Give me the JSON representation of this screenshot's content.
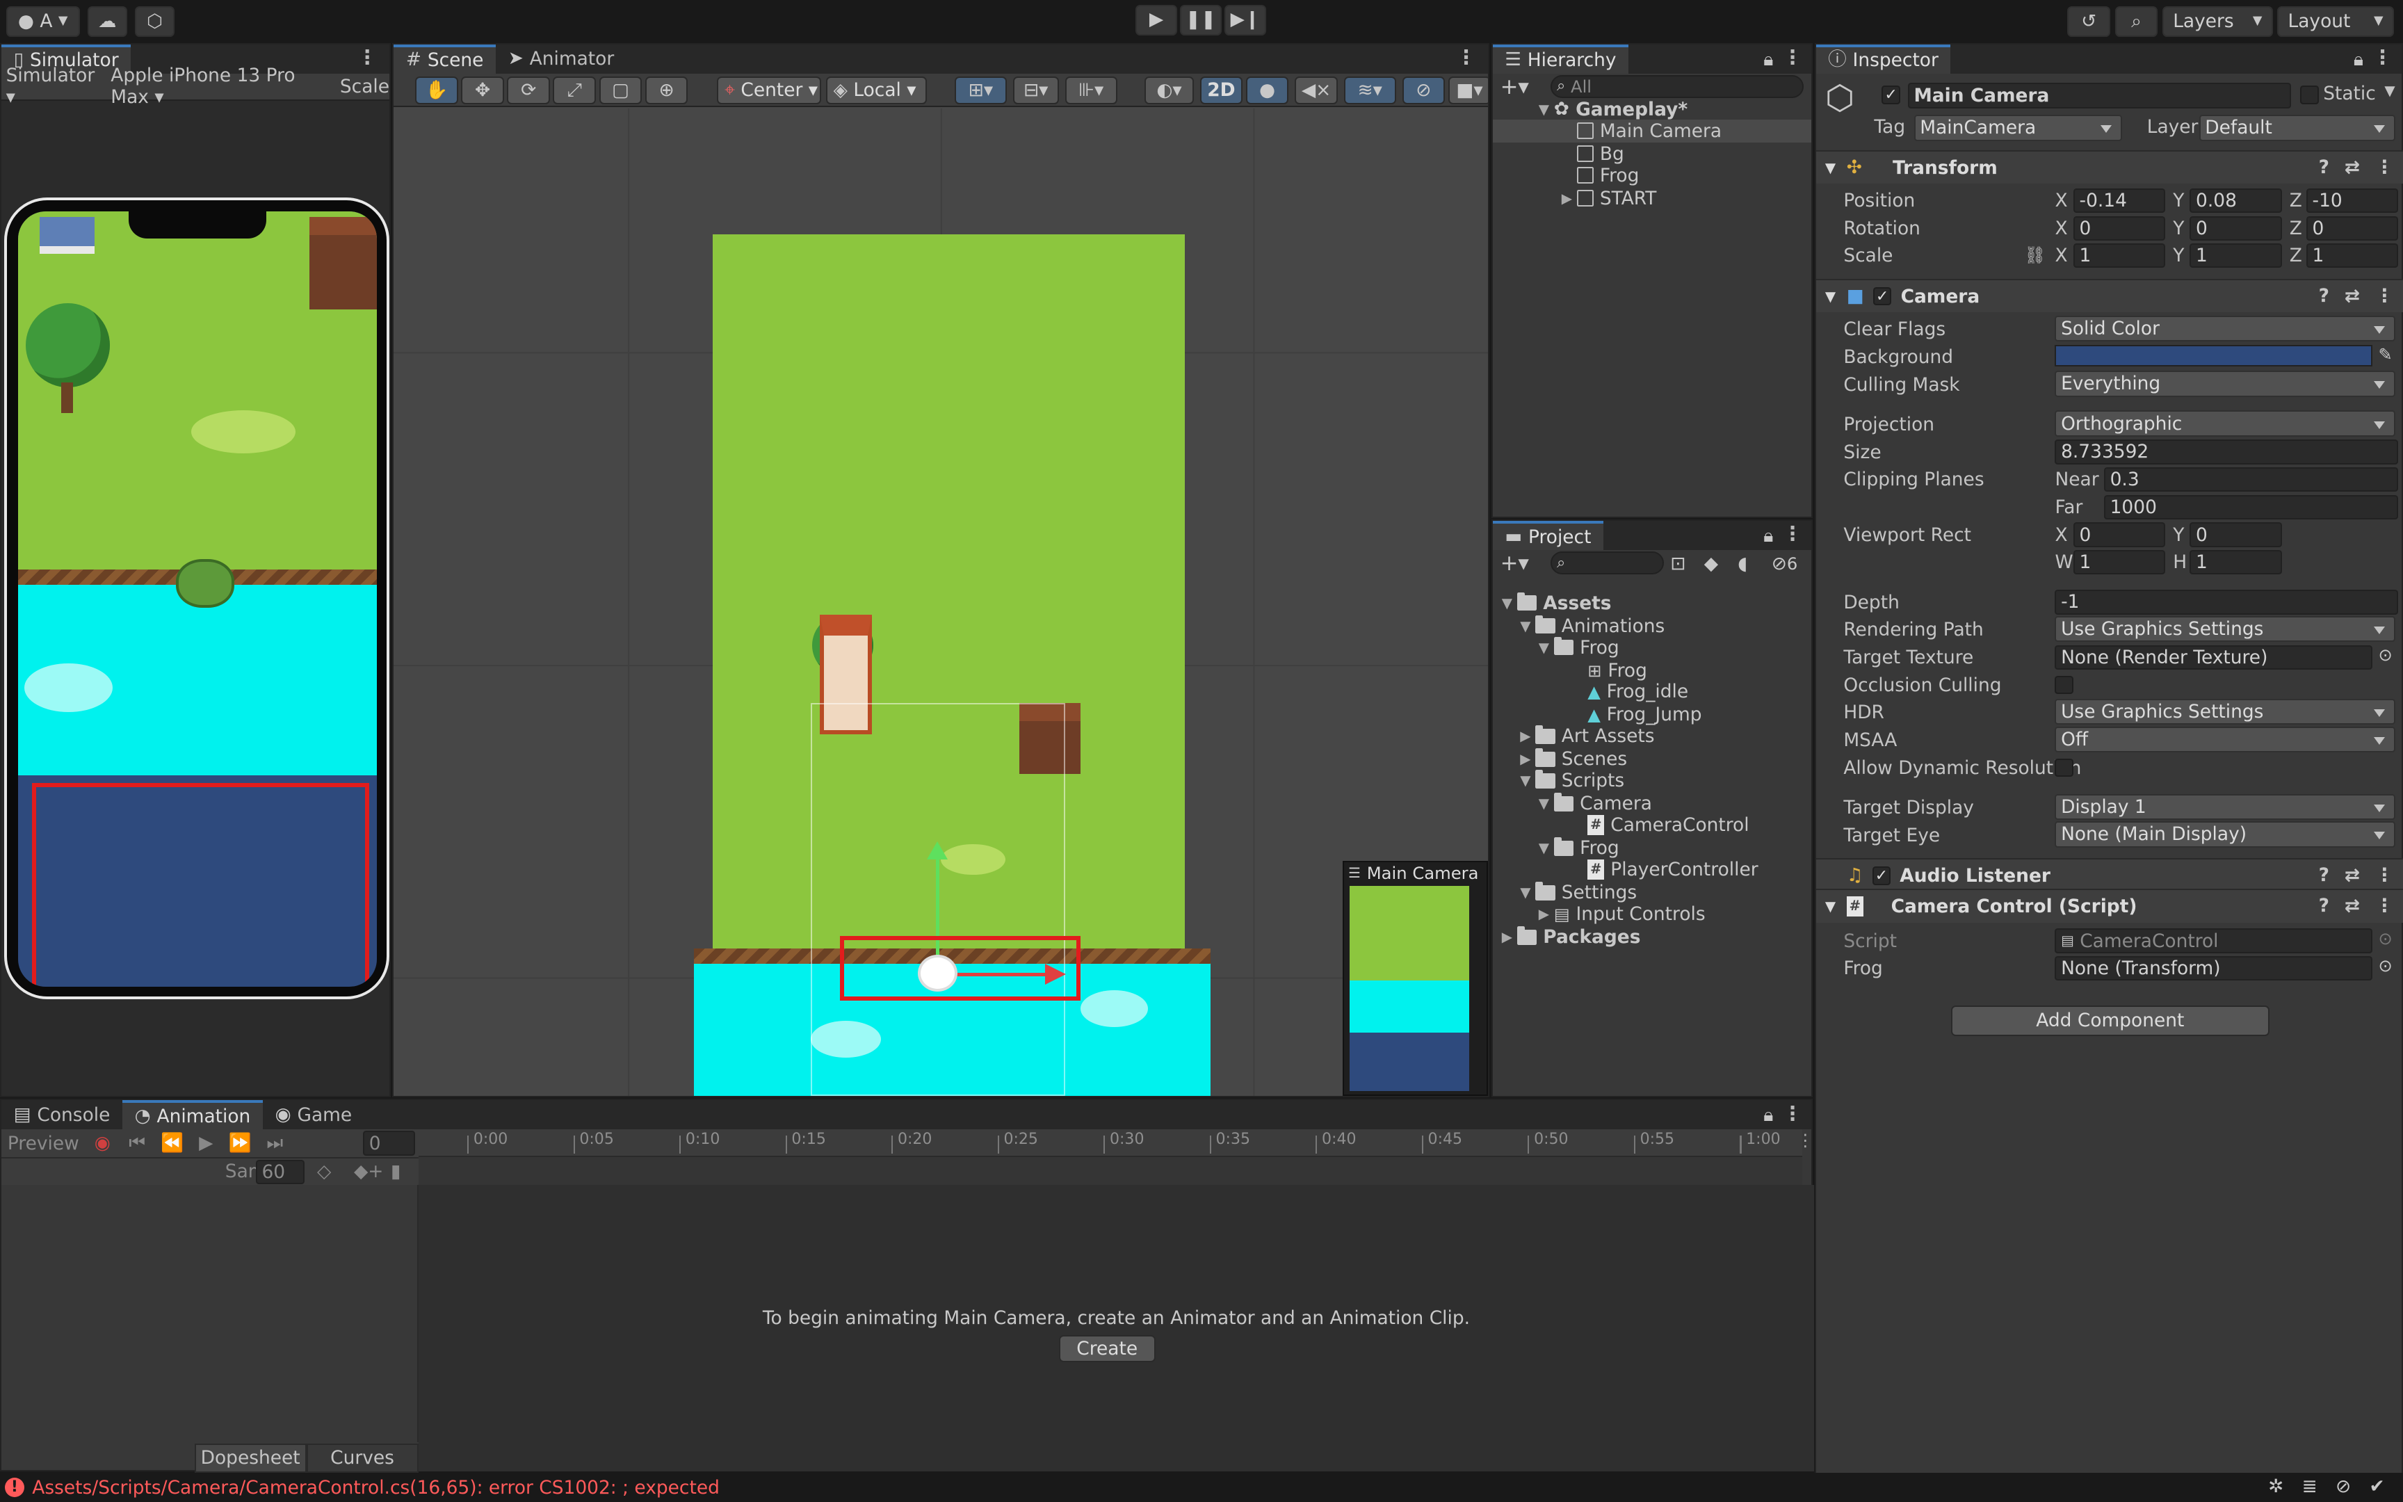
{
  "toolbar": {
    "account_label": "A",
    "layers_label": "Layers",
    "layout_label": "Layout"
  },
  "simulator": {
    "tab": "Simulator",
    "mode": "Simulator",
    "device": "Apple iPhone 13 Pro Max",
    "scale_label": "Scale"
  },
  "scene": {
    "tabs": [
      "Scene",
      "Animator"
    ],
    "pivot": "Center",
    "space": "Local",
    "mode_2d": "2D",
    "camera_preview_title": "Main Camera"
  },
  "hierarchy": {
    "tab": "Hierarchy",
    "search_placeholder": "All",
    "scene_name": "Gameplay*",
    "items": [
      "Main Camera",
      "Bg",
      "Frog",
      "START"
    ]
  },
  "project": {
    "tab": "Project",
    "hidden_count": "6",
    "tree": [
      {
        "label": "Assets",
        "type": "folder"
      },
      {
        "label": "Animations",
        "type": "folder"
      },
      {
        "label": "Frog",
        "type": "folder"
      },
      {
        "label": "Frog",
        "type": "controller"
      },
      {
        "label": "Frog_idle",
        "type": "anim"
      },
      {
        "label": "Frog_Jump",
        "type": "anim"
      },
      {
        "label": "Art Assets",
        "type": "folder"
      },
      {
        "label": "Scenes",
        "type": "folder"
      },
      {
        "label": "Scripts",
        "type": "folder"
      },
      {
        "label": "Camera",
        "type": "folder"
      },
      {
        "label": "CameraControl",
        "type": "script"
      },
      {
        "label": "Frog",
        "type": "folder"
      },
      {
        "label": "PlayerController",
        "type": "script"
      },
      {
        "label": "Settings",
        "type": "folder"
      },
      {
        "label": "Input Controls",
        "type": "asset"
      },
      {
        "label": "Packages",
        "type": "folder"
      }
    ]
  },
  "inspector": {
    "tab": "Inspector",
    "object_name": "Main Camera",
    "static_label": "Static",
    "tag_label": "Tag",
    "tag_value": "MainCamera",
    "layer_label": "Layer",
    "layer_value": "Default",
    "transform": {
      "title": "Transform",
      "position_label": "Position",
      "px": "-0.14",
      "py": "0.08",
      "pz": "-10",
      "rotation_label": "Rotation",
      "rx": "0",
      "ry": "0",
      "rz": "0",
      "scale_label": "Scale",
      "sx": "1",
      "sy": "1",
      "sz": "1"
    },
    "camera": {
      "title": "Camera",
      "clear_flags_label": "Clear Flags",
      "clear_flags": "Solid Color",
      "background_label": "Background",
      "background_color": "#2e4a7d",
      "culling_mask_label": "Culling Mask",
      "culling_mask": "Everything",
      "projection_label": "Projection",
      "projection": "Orthographic",
      "size_label": "Size",
      "size": "8.733592",
      "clipping_label": "Clipping Planes",
      "near_label": "Near",
      "near": "0.3",
      "far_label": "Far",
      "far": "1000",
      "viewport_label": "Viewport Rect",
      "vx": "0",
      "vy": "0",
      "vw": "1",
      "vh": "1",
      "depth_label": "Depth",
      "depth": "-1",
      "rendering_path_label": "Rendering Path",
      "rendering_path": "Use Graphics Settings",
      "target_texture_label": "Target Texture",
      "target_texture": "None (Render Texture)",
      "occlusion_label": "Occlusion Culling",
      "hdr_label": "HDR",
      "hdr": "Use Graphics Settings",
      "msaa_label": "MSAA",
      "msaa": "Off",
      "dynres_label": "Allow Dynamic Resolution",
      "target_display_label": "Target Display",
      "target_display": "Display 1",
      "target_eye_label": "Target Eye",
      "target_eye": "None (Main Display)"
    },
    "audio_listener_title": "Audio Listener",
    "camera_control": {
      "title": "Camera Control (Script)",
      "script_label": "Script",
      "script_value": "CameraControl",
      "frog_label": "Frog",
      "frog_value": "None (Transform)"
    },
    "add_component": "Add Component"
  },
  "bottom": {
    "tabs": [
      "Console",
      "Animation",
      "Game"
    ],
    "preview_label": "Preview",
    "frame": "0",
    "samples_label": "Samples",
    "samples": "60",
    "timeline_ticks": [
      "0:00",
      "0:05",
      "0:10",
      "0:15",
      "0:20",
      "0:25",
      "0:30",
      "0:35",
      "0:40",
      "0:45",
      "0:50",
      "0:55",
      "1:00"
    ],
    "message": "To begin animating Main Camera, create an Animator and an Animation Clip.",
    "create_label": "Create",
    "dopesheet_label": "Dopesheet",
    "curves_label": "Curves"
  },
  "status": {
    "error_text": "Assets/Scripts/Camera/CameraControl.cs(16,65): error CS1002: ; expected",
    "error_color": "#ff5a5a"
  }
}
